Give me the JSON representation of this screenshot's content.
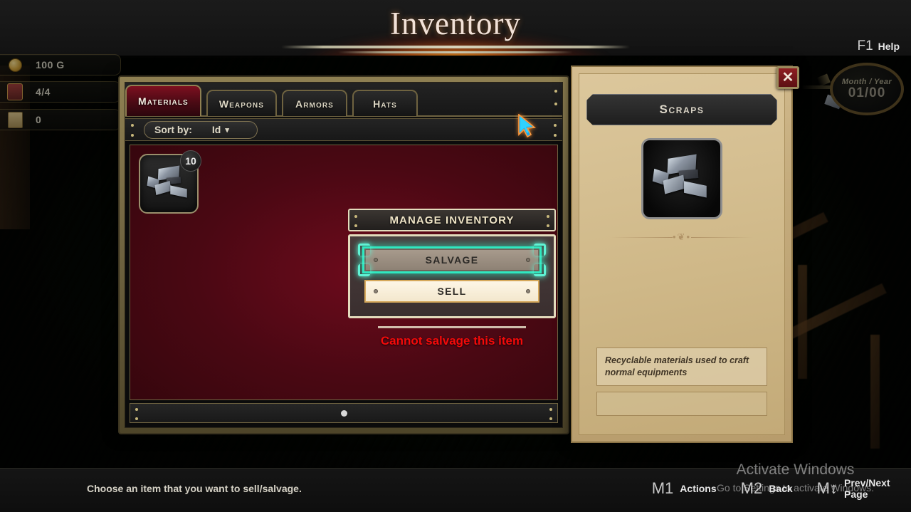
{
  "window": {
    "title": "Inventory",
    "help_key": "F1",
    "help_label": "Help",
    "close_icon": "close-x-icon"
  },
  "hud": {
    "gold": "100 G",
    "party": "4/4",
    "third_stat": "0",
    "clock_label": "Month / Year",
    "clock_value": "01/00"
  },
  "tabs": [
    {
      "label": "Materials",
      "active": true
    },
    {
      "label": "Weapons",
      "active": false
    },
    {
      "label": "Armors",
      "active": false
    },
    {
      "label": "Hats",
      "active": false
    }
  ],
  "sort": {
    "label": "Sort by:",
    "value": "Id",
    "chevron": "▾"
  },
  "grid": {
    "items": [
      {
        "name": "Scraps",
        "quantity": "10",
        "selected": true
      }
    ],
    "page_dots": 1
  },
  "detail": {
    "title": "Scraps",
    "icon": "scraps-item-icon",
    "divider_ornament": "•❦•",
    "description": "Recyclable materials used to craft normal equipments"
  },
  "dialog": {
    "title": "MANAGE INVENTORY",
    "options": [
      {
        "label": "SALVAGE",
        "selected": true
      },
      {
        "label": "SELL",
        "selected": false
      }
    ],
    "error": "Cannot salvage this item"
  },
  "footer": {
    "status": "Choose an item that you want to sell/salvage.",
    "hints": [
      {
        "key": "M1",
        "label": "Actions"
      },
      {
        "key": "M2",
        "label": "Back"
      },
      {
        "key": "M↕",
        "label": "Prev/Next Page"
      }
    ]
  },
  "watermark": {
    "title": "Activate Windows",
    "subtitle": "Go to Settings to activate Windows."
  },
  "colors": {
    "accent_gold": "#8f8052",
    "tab_active_red": "#7d1020",
    "grid_bg_red": "#6d0b1c",
    "paper_tan": "#cfb888",
    "selection_teal": "#2fe8c0",
    "error_red": "#f40a0a"
  }
}
